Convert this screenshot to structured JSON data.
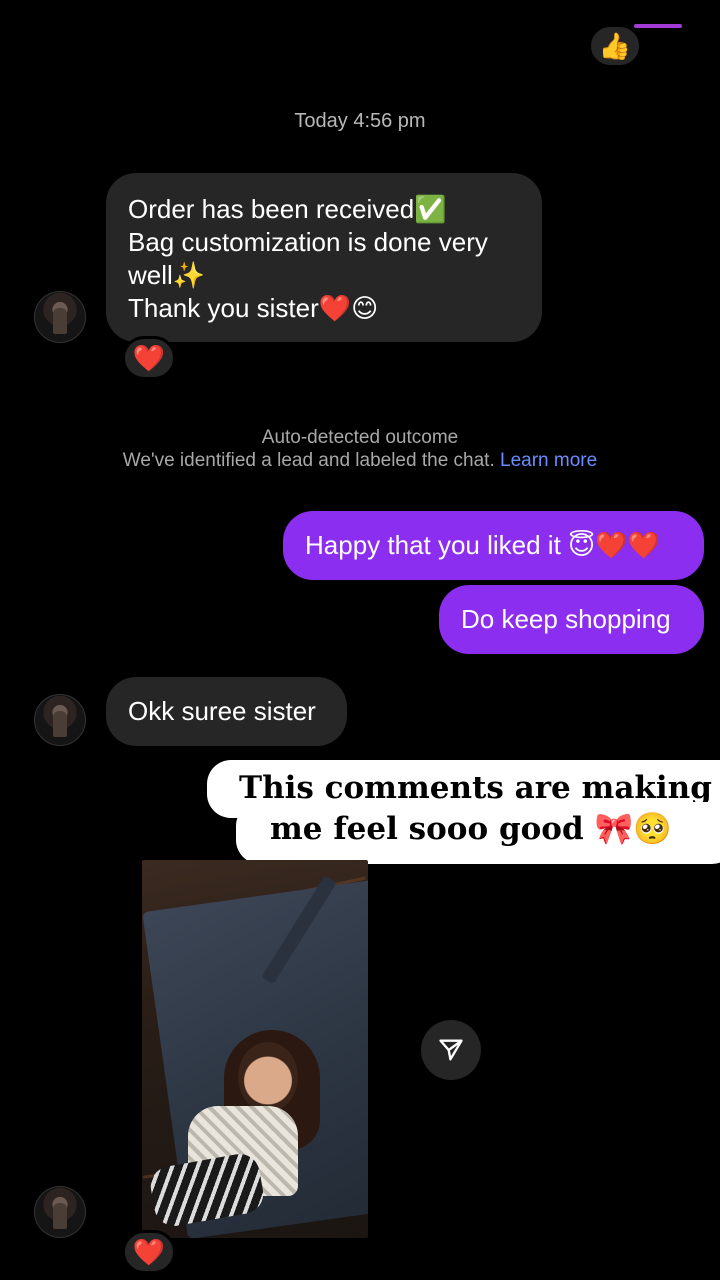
{
  "top_reaction": {
    "emoji": "👍"
  },
  "timestamp": "Today 4:56 pm",
  "messages": {
    "order": {
      "lines": [
        "Order has been received✅",
        "Bag customization is done very",
        "well✨",
        "Thank you sister❤️😊"
      ],
      "reaction": "❤️"
    },
    "notice": {
      "title": "Auto-detected outcome",
      "body": "We've identified a lead and labeled the chat.",
      "link": "Learn more"
    },
    "reply_1": "Happy that you liked it 😇❤️❤️",
    "reply_2": "Do keep shopping",
    "incoming_2": "Okk suree sister",
    "photo_reaction": "❤️"
  },
  "caption": {
    "line1": "This comments are making",
    "line2": "me feel sooo good 🎀🥺"
  },
  "icons": {
    "share": "send-icon",
    "avatar": "contact-avatar"
  },
  "colors": {
    "background": "#000000",
    "incoming_bubble": "#262626",
    "outgoing_bubble": "#8c2ef0",
    "link": "#6b8cff"
  }
}
